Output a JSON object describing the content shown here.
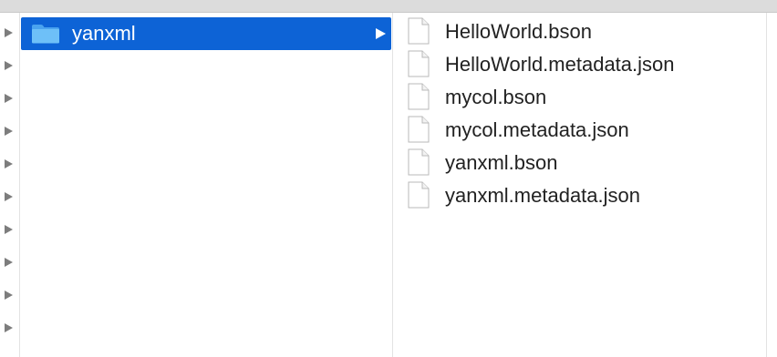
{
  "colors": {
    "selection": "#0d63d6",
    "folder_fill": "#5bb3f5",
    "text": "#222222",
    "selected_text": "#ffffff"
  },
  "sidebar_rows": [
    {
      "icon": "disclosure-triangle-icon"
    },
    {
      "icon": "disclosure-triangle-icon"
    },
    {
      "icon": "disclosure-triangle-icon"
    },
    {
      "icon": "disclosure-triangle-icon"
    },
    {
      "icon": "disclosure-triangle-icon"
    },
    {
      "icon": "disclosure-triangle-icon"
    },
    {
      "icon": "disclosure-triangle-icon"
    },
    {
      "icon": "disclosure-triangle-icon"
    },
    {
      "icon": "disclosure-triangle-icon"
    },
    {
      "icon": "disclosure-triangle-icon"
    }
  ],
  "folder": {
    "name": "yanxml",
    "icon": "folder-icon"
  },
  "files": [
    {
      "name": "HelloWorld.bson",
      "icon": "file-icon"
    },
    {
      "name": "HelloWorld.metadata.json",
      "icon": "file-icon"
    },
    {
      "name": "mycol.bson",
      "icon": "file-icon"
    },
    {
      "name": "mycol.metadata.json",
      "icon": "file-icon"
    },
    {
      "name": "yanxml.bson",
      "icon": "file-icon"
    },
    {
      "name": "yanxml.metadata.json",
      "icon": "file-icon"
    }
  ]
}
